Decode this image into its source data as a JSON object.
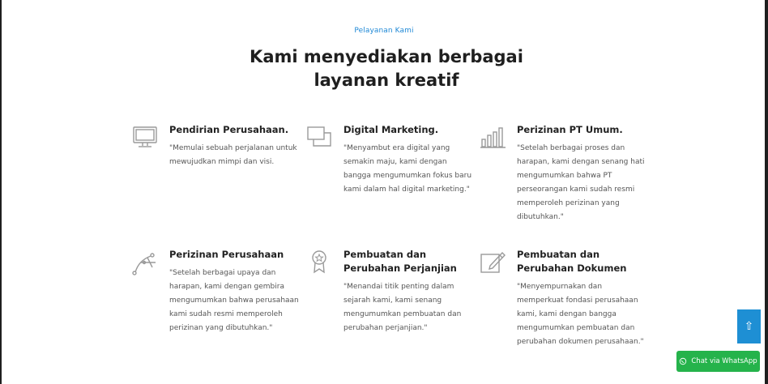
{
  "section": {
    "subtitle": "Pelayanan Kami",
    "title_line1": "Kami menyediakan berbagai",
    "title_line2": "layanan kreatif"
  },
  "services": [
    {
      "title": "Pendirian Perusahaan.",
      "desc": "\"Memulai sebuah perjalanan untuk mewujudkan mimpi dan visi.",
      "icon": "monitor-icon"
    },
    {
      "title": "Digital Marketing.",
      "desc": "\"Menyambut era digital yang semakin maju, kami dengan bangga mengumumkan fokus baru kami dalam hal digital marketing.\"",
      "icon": "windows-icon"
    },
    {
      "title": "Perizinan PT Umum.",
      "desc": "\"Setelah berbagai proses dan harapan, kami dengan senang hati mengumumkan bahwa PT perseorangan kami sudah resmi memperoleh perizinan yang dibutuhkan.\"",
      "icon": "bar-chart-icon"
    },
    {
      "title": "Perizinan Perusahaan",
      "desc": "\"Setelah berbagai upaya dan harapan, kami dengan gembira mengumumkan bahwa perusahaan kami sudah resmi memperoleh perizinan yang dibutuhkan.\"",
      "icon": "pen-tool-icon"
    },
    {
      "title": "Pembuatan dan Perubahan Perjanjian",
      "desc": "\"Menandai titik penting dalam sejarah kami, kami senang mengumumkan pembuatan dan perubahan perjanjian.\"",
      "icon": "award-icon"
    },
    {
      "title": "Pembuatan dan Perubahan Dokumen",
      "desc": "\"Menyempurnakan dan memperkuat fondasi perusahaan kami, kami dengan bangga mengumumkan pembuatan dan perubahan dokumen perusahaan.\"",
      "icon": "edit-document-icon"
    }
  ],
  "floating": {
    "scroll_top_icon": "⇧",
    "whatsapp_label": "Chat via WhatsApp"
  }
}
